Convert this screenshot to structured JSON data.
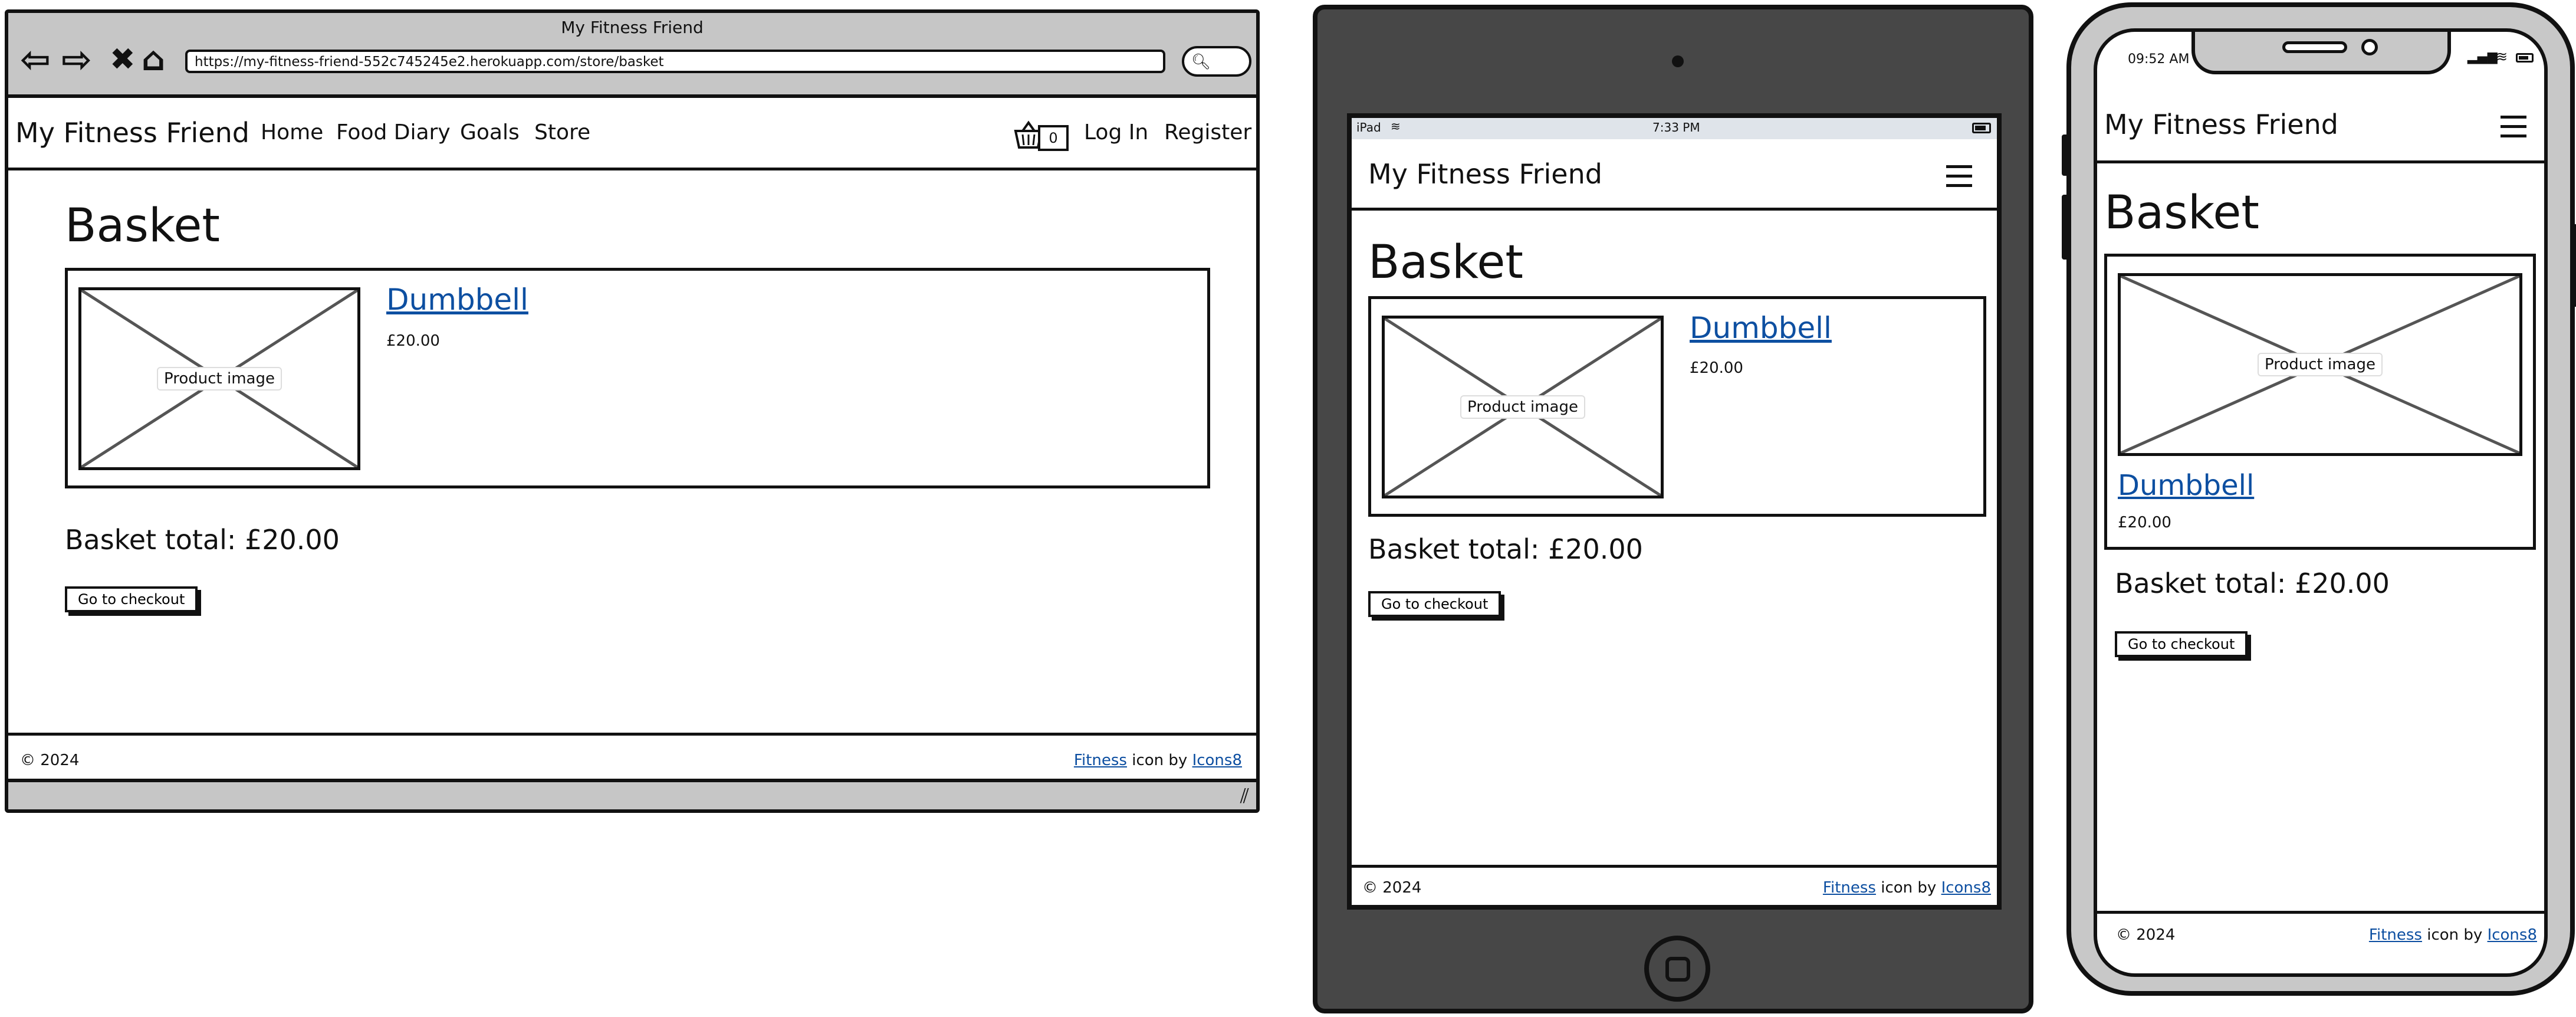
{
  "site": {
    "brand": "My Fitness Friend",
    "nav": [
      "Home",
      "Food Diary",
      "Goals",
      "Store"
    ],
    "login": "Log In",
    "register": "Register",
    "cart_count": "0"
  },
  "browser": {
    "window_title": "My Fitness Friend",
    "url": "https://my-fitness-friend-552c745245e2.herokuapp.com/store/basket"
  },
  "page": {
    "title": "Basket",
    "product_name": "Dumbbell",
    "product_price": "£20.00",
    "image_placeholder": "Product image",
    "basket_total": "Basket total: £20.00",
    "checkout_button": "Go to checkout"
  },
  "footer": {
    "copyright": "© 2024",
    "link1": "Fitness",
    "middle": " icon by ",
    "link2": "Icons8"
  },
  "tablet": {
    "device": "iPad",
    "time": "7:33 PM"
  },
  "phone": {
    "time": "09:52 AM"
  },
  "icons": [
    "back-arrow-icon",
    "forward-arrow-icon",
    "close-icon",
    "home-icon",
    "search-icon",
    "basket-icon",
    "hamburger-menu-icon",
    "wifi-icon",
    "battery-icon",
    "signal-icon",
    "resize-grip-icon"
  ]
}
